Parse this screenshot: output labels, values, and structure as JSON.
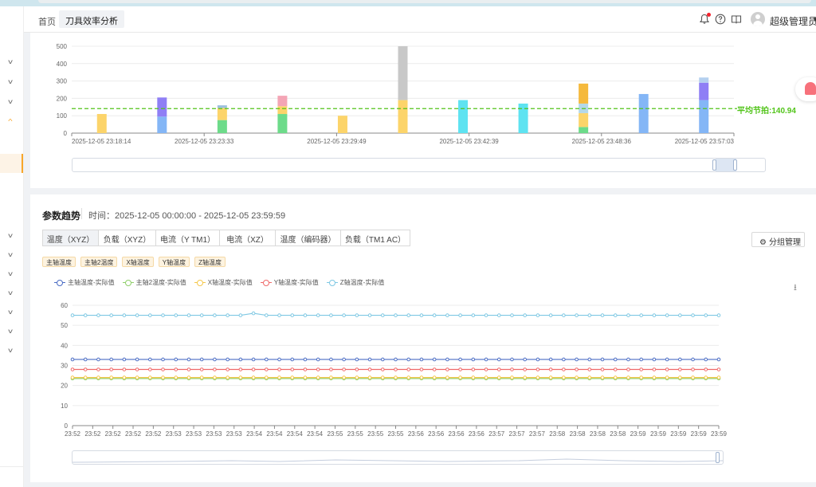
{
  "header": {
    "tab_home": "首页",
    "tab_active": "刀具效率分析",
    "tab_close": "×",
    "username": "超级管理员",
    "icons": [
      "bell-icon",
      "help-icon",
      "book-icon",
      "avatar"
    ]
  },
  "sidebar": {
    "items": [
      "chevron-down-icon",
      "chevron-down-icon",
      "chevron-down-icon",
      "chevron-up-icon",
      "chevron-down-icon",
      "chevron-down-icon",
      "chevron-down-icon",
      "chevron-down-icon",
      "chevron-down-icon",
      "chevron-down-icon",
      "chevron-down-icon"
    ],
    "accent": "#f7a72b"
  },
  "bar_panel": {
    "avg_label": "平均节拍:140.94",
    "avg_color": "#52c41a"
  },
  "trend_panel": {
    "title": "参数趋势",
    "time_range": "时间：2025-12-05 00:00:00 - 2025-12-05 23:59:59",
    "tabs": [
      "温度（XYZ）",
      "负载（XYZ）",
      "电流（Y TM1）",
      "电流（XZ）",
      "温度（编码器）",
      "负载（TM1 AC）"
    ],
    "active_tab": 0,
    "group_button": "分组管理",
    "chips": [
      "主轴温度",
      "主轴2温度",
      "X轴温度",
      "Y轴温度",
      "Z轴温度"
    ]
  },
  "chart_data": [
    {
      "type": "bar",
      "stacked": true,
      "ylim": [
        0,
        500
      ],
      "yticks": [
        0,
        100,
        200,
        300,
        400,
        500
      ],
      "x_tick_labels": [
        "2025-12-05 23:18:14",
        "2025-12-05 23:23:33",
        "2025-12-05 23:29:49",
        "2025-12-05 23:42:39",
        "2025-12-05 23:48:36",
        "2025-12-05 23:57:03"
      ],
      "reference_line": {
        "label": "平均节拍:140.94",
        "value": 140.94,
        "color": "#52c41a"
      },
      "bars": [
        {
          "x": 0,
          "segments": [
            {
              "value": 110,
              "color": "#fcd46a"
            }
          ]
        },
        {
          "x": 1,
          "segments": [
            {
              "value": 95,
              "color": "#84b6f6"
            },
            {
              "value": 110,
              "color": "#8f7ff5"
            }
          ]
        },
        {
          "x": 2,
          "segments": [
            {
              "value": 75,
              "color": "#6ddb8a"
            },
            {
              "value": 70,
              "color": "#fcd46a"
            },
            {
              "value": 15,
              "color": "#9cc0dd"
            }
          ]
        },
        {
          "x": 3,
          "segments": [
            {
              "value": 110,
              "color": "#6ddb8a"
            },
            {
              "value": 45,
              "color": "#fcd46a"
            },
            {
              "value": 60,
              "color": "#f4a5b5"
            }
          ]
        },
        {
          "x": 4,
          "segments": [
            {
              "value": 100,
              "color": "#fcd46a"
            }
          ]
        },
        {
          "x": 5,
          "segments": [
            {
              "value": 190,
              "color": "#fcd46a"
            },
            {
              "value": 400,
              "color": "#c8c8c8"
            }
          ]
        },
        {
          "x": 6,
          "segments": [
            {
              "value": 190,
              "color": "#5ee3f1"
            }
          ]
        },
        {
          "x": 7,
          "segments": [
            {
              "value": 170,
              "color": "#5ee3f1"
            }
          ]
        },
        {
          "x": 8,
          "segments": [
            {
              "value": 35,
              "color": "#6ddb8a"
            },
            {
              "value": 80,
              "color": "#fcd46a"
            },
            {
              "value": 55,
              "color": "#b4d8e8"
            },
            {
              "value": 115,
              "color": "#f5b93c"
            }
          ]
        },
        {
          "x": 9,
          "segments": [
            {
              "value": 225,
              "color": "#84b6f6"
            }
          ]
        },
        {
          "x": 10,
          "segments": [
            {
              "value": 190,
              "color": "#84b6f6"
            },
            {
              "value": 100,
              "color": "#8f7ff5"
            },
            {
              "value": 30,
              "color": "#b4d0ef"
            }
          ]
        }
      ]
    },
    {
      "type": "line",
      "ylim": [
        0,
        60
      ],
      "yticks": [
        0,
        10,
        20,
        30,
        40,
        50,
        60
      ],
      "categories": [
        "23:52",
        "23:52",
        "23:52",
        "23:52",
        "23:52",
        "23:53",
        "23:53",
        "23:53",
        "23:53",
        "23:54",
        "23:54",
        "23:54",
        "23:54",
        "23:55",
        "23:55",
        "23:55",
        "23:55",
        "23:56",
        "23:56",
        "23:56",
        "23:56",
        "23:57",
        "23:57",
        "23:57",
        "23:58",
        "23:58",
        "23:58",
        "23:58",
        "23:59",
        "23:59",
        "23:59",
        "23:59",
        "23:59"
      ],
      "series": [
        {
          "name": "主轴温度-实际值",
          "color": "#4a6cc4",
          "values": [
            33,
            33,
            33,
            33,
            33,
            33,
            33,
            33,
            33,
            33,
            33,
            33,
            33,
            33,
            33,
            33,
            33,
            33,
            33,
            33,
            33,
            33,
            33,
            33,
            33,
            33,
            33,
            33,
            33,
            33,
            33,
            33,
            33,
            33,
            33,
            33,
            33,
            33,
            33,
            33,
            33,
            33,
            33,
            33,
            33,
            33,
            33,
            33,
            33,
            33,
            33
          ]
        },
        {
          "name": "主轴2温度-实际值",
          "color": "#8fcf6a",
          "values": [
            23.5,
            23.5,
            23.5,
            23.5,
            23.5,
            23.5,
            23.5,
            23.5,
            23.5,
            23.5,
            23.5,
            23.5,
            23.5,
            23.5,
            23.5,
            23.5,
            23.5,
            23.5,
            23.5,
            23.5,
            23.5,
            23.5,
            23.5,
            23.5,
            23.5,
            23.5,
            23.5,
            23.5,
            23.5,
            23.5,
            23.5,
            23.5,
            23.5,
            23.5,
            23.5,
            23.5,
            23.5,
            23.5,
            23.5,
            23.5,
            23.5,
            23.5,
            23.5,
            23.5,
            23.5,
            23.5,
            23.5,
            23.5,
            23.5,
            23.5,
            23.5
          ]
        },
        {
          "name": "X轴温度-实际值",
          "color": "#f5c84c",
          "values": [
            24,
            24,
            24,
            24,
            24,
            24,
            24,
            24,
            24,
            24,
            24,
            24,
            24,
            24,
            24,
            24,
            24,
            24,
            24,
            24,
            24,
            24,
            24,
            24,
            24,
            24,
            24,
            24,
            24,
            24,
            24,
            24,
            24,
            24,
            24,
            24,
            24,
            24,
            24,
            24,
            24,
            24,
            24,
            24,
            24,
            24,
            24,
            24,
            24,
            24,
            24
          ]
        },
        {
          "name": "Y轴温度-实际值",
          "color": "#ef6a6a",
          "values": [
            28,
            28,
            28,
            28,
            28,
            28,
            28,
            28,
            28,
            28,
            28,
            28,
            28,
            28,
            28,
            28,
            28,
            28,
            28,
            28,
            28,
            28,
            28,
            28,
            28,
            28,
            28,
            28,
            28,
            28,
            28,
            28,
            28,
            28,
            28,
            28,
            28,
            28,
            28,
            28,
            28,
            28,
            28,
            28,
            28,
            28,
            28,
            28,
            28,
            28,
            28
          ]
        },
        {
          "name": "Z轴温度-实际值",
          "color": "#7ec8e3",
          "values": [
            55,
            55,
            55,
            55,
            55,
            55,
            55,
            55,
            55,
            55,
            55,
            55,
            55,
            55,
            56,
            55,
            55,
            55,
            55,
            55,
            55,
            55,
            55,
            55,
            55,
            55,
            55,
            55,
            55,
            55,
            55,
            55,
            55,
            55,
            55,
            55,
            55,
            55,
            55,
            55,
            55,
            55,
            55,
            55,
            55,
            55,
            55,
            55,
            55,
            55,
            55
          ]
        }
      ]
    }
  ]
}
